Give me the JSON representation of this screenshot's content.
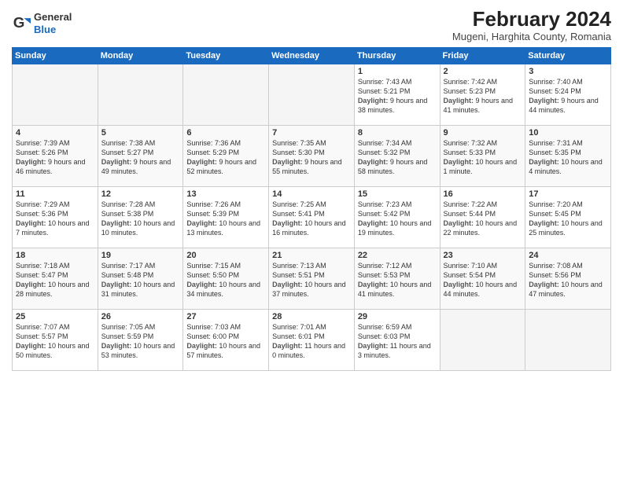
{
  "header": {
    "logo": {
      "general": "General",
      "blue": "Blue"
    },
    "title": "February 2024",
    "location": "Mugeni, Harghita County, Romania"
  },
  "weekdays": [
    "Sunday",
    "Monday",
    "Tuesday",
    "Wednesday",
    "Thursday",
    "Friday",
    "Saturday"
  ],
  "weeks": [
    [
      {
        "day": "",
        "empty": true
      },
      {
        "day": "",
        "empty": true
      },
      {
        "day": "",
        "empty": true
      },
      {
        "day": "",
        "empty": true
      },
      {
        "day": "1",
        "sunrise": "7:43 AM",
        "sunset": "5:21 PM",
        "daylight": "9 hours and 38 minutes."
      },
      {
        "day": "2",
        "sunrise": "7:42 AM",
        "sunset": "5:23 PM",
        "daylight": "9 hours and 41 minutes."
      },
      {
        "day": "3",
        "sunrise": "7:40 AM",
        "sunset": "5:24 PM",
        "daylight": "9 hours and 44 minutes."
      }
    ],
    [
      {
        "day": "4",
        "sunrise": "7:39 AM",
        "sunset": "5:26 PM",
        "daylight": "9 hours and 46 minutes."
      },
      {
        "day": "5",
        "sunrise": "7:38 AM",
        "sunset": "5:27 PM",
        "daylight": "9 hours and 49 minutes."
      },
      {
        "day": "6",
        "sunrise": "7:36 AM",
        "sunset": "5:29 PM",
        "daylight": "9 hours and 52 minutes."
      },
      {
        "day": "7",
        "sunrise": "7:35 AM",
        "sunset": "5:30 PM",
        "daylight": "9 hours and 55 minutes."
      },
      {
        "day": "8",
        "sunrise": "7:34 AM",
        "sunset": "5:32 PM",
        "daylight": "9 hours and 58 minutes."
      },
      {
        "day": "9",
        "sunrise": "7:32 AM",
        "sunset": "5:33 PM",
        "daylight": "10 hours and 1 minute."
      },
      {
        "day": "10",
        "sunrise": "7:31 AM",
        "sunset": "5:35 PM",
        "daylight": "10 hours and 4 minutes."
      }
    ],
    [
      {
        "day": "11",
        "sunrise": "7:29 AM",
        "sunset": "5:36 PM",
        "daylight": "10 hours and 7 minutes."
      },
      {
        "day": "12",
        "sunrise": "7:28 AM",
        "sunset": "5:38 PM",
        "daylight": "10 hours and 10 minutes."
      },
      {
        "day": "13",
        "sunrise": "7:26 AM",
        "sunset": "5:39 PM",
        "daylight": "10 hours and 13 minutes."
      },
      {
        "day": "14",
        "sunrise": "7:25 AM",
        "sunset": "5:41 PM",
        "daylight": "10 hours and 16 minutes."
      },
      {
        "day": "15",
        "sunrise": "7:23 AM",
        "sunset": "5:42 PM",
        "daylight": "10 hours and 19 minutes."
      },
      {
        "day": "16",
        "sunrise": "7:22 AM",
        "sunset": "5:44 PM",
        "daylight": "10 hours and 22 minutes."
      },
      {
        "day": "17",
        "sunrise": "7:20 AM",
        "sunset": "5:45 PM",
        "daylight": "10 hours and 25 minutes."
      }
    ],
    [
      {
        "day": "18",
        "sunrise": "7:18 AM",
        "sunset": "5:47 PM",
        "daylight": "10 hours and 28 minutes."
      },
      {
        "day": "19",
        "sunrise": "7:17 AM",
        "sunset": "5:48 PM",
        "daylight": "10 hours and 31 minutes."
      },
      {
        "day": "20",
        "sunrise": "7:15 AM",
        "sunset": "5:50 PM",
        "daylight": "10 hours and 34 minutes."
      },
      {
        "day": "21",
        "sunrise": "7:13 AM",
        "sunset": "5:51 PM",
        "daylight": "10 hours and 37 minutes."
      },
      {
        "day": "22",
        "sunrise": "7:12 AM",
        "sunset": "5:53 PM",
        "daylight": "10 hours and 41 minutes."
      },
      {
        "day": "23",
        "sunrise": "7:10 AM",
        "sunset": "5:54 PM",
        "daylight": "10 hours and 44 minutes."
      },
      {
        "day": "24",
        "sunrise": "7:08 AM",
        "sunset": "5:56 PM",
        "daylight": "10 hours and 47 minutes."
      }
    ],
    [
      {
        "day": "25",
        "sunrise": "7:07 AM",
        "sunset": "5:57 PM",
        "daylight": "10 hours and 50 minutes."
      },
      {
        "day": "26",
        "sunrise": "7:05 AM",
        "sunset": "5:59 PM",
        "daylight": "10 hours and 53 minutes."
      },
      {
        "day": "27",
        "sunrise": "7:03 AM",
        "sunset": "6:00 PM",
        "daylight": "10 hours and 57 minutes."
      },
      {
        "day": "28",
        "sunrise": "7:01 AM",
        "sunset": "6:01 PM",
        "daylight": "11 hours and 0 minutes."
      },
      {
        "day": "29",
        "sunrise": "6:59 AM",
        "sunset": "6:03 PM",
        "daylight": "11 hours and 3 minutes."
      },
      {
        "day": "",
        "empty": true
      },
      {
        "day": "",
        "empty": true
      }
    ]
  ]
}
